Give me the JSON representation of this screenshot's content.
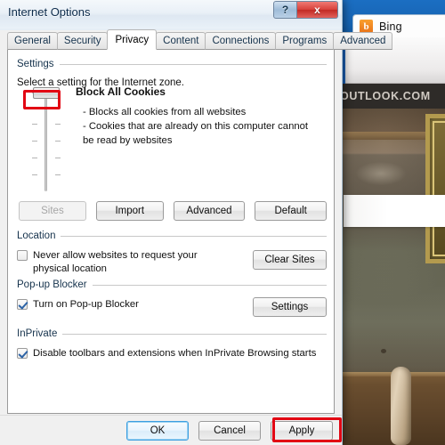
{
  "browser": {
    "tab_label": "Bing",
    "favicon": "bing-b-icon",
    "nav_brand": "OUTLOOK.COM"
  },
  "dialog": {
    "title": "Internet Options",
    "window_buttons": {
      "help": "?",
      "close": "x"
    },
    "tabs": [
      {
        "label": "General",
        "active": false
      },
      {
        "label": "Security",
        "active": false
      },
      {
        "label": "Privacy",
        "active": true
      },
      {
        "label": "Content",
        "active": false
      },
      {
        "label": "Connections",
        "active": false
      },
      {
        "label": "Programs",
        "active": false
      },
      {
        "label": "Advanced",
        "active": false
      }
    ],
    "settings": {
      "group_label": "Settings",
      "instruction": "Select a setting for the Internet zone.",
      "zone_title": "Block All Cookies",
      "zone_description": "- Blocks all cookies from all websites\n- Cookies that are already on this computer cannot be read by websites",
      "slider_position": "top",
      "buttons": {
        "sites": "Sites",
        "sites_disabled": true,
        "import": "Import",
        "advanced": "Advanced",
        "default": "Default"
      }
    },
    "location": {
      "group_label": "Location",
      "checkbox_label": "Never allow websites to request your physical location",
      "checked": false,
      "clear_button": "Clear Sites"
    },
    "popup_blocker": {
      "group_label": "Pop-up Blocker",
      "checkbox_label": "Turn on Pop-up Blocker",
      "checked": true,
      "settings_button": "Settings"
    },
    "inprivate": {
      "group_label": "InPrivate",
      "checkbox_label": "Disable toolbars and extensions when InPrivate Browsing starts",
      "checked": true
    },
    "footer": {
      "ok": "OK",
      "cancel": "Cancel",
      "apply": "Apply"
    }
  },
  "annotations": {
    "highlight_color": "#e20613",
    "targets": [
      "privacy-slider-thumb",
      "apply-button"
    ]
  }
}
